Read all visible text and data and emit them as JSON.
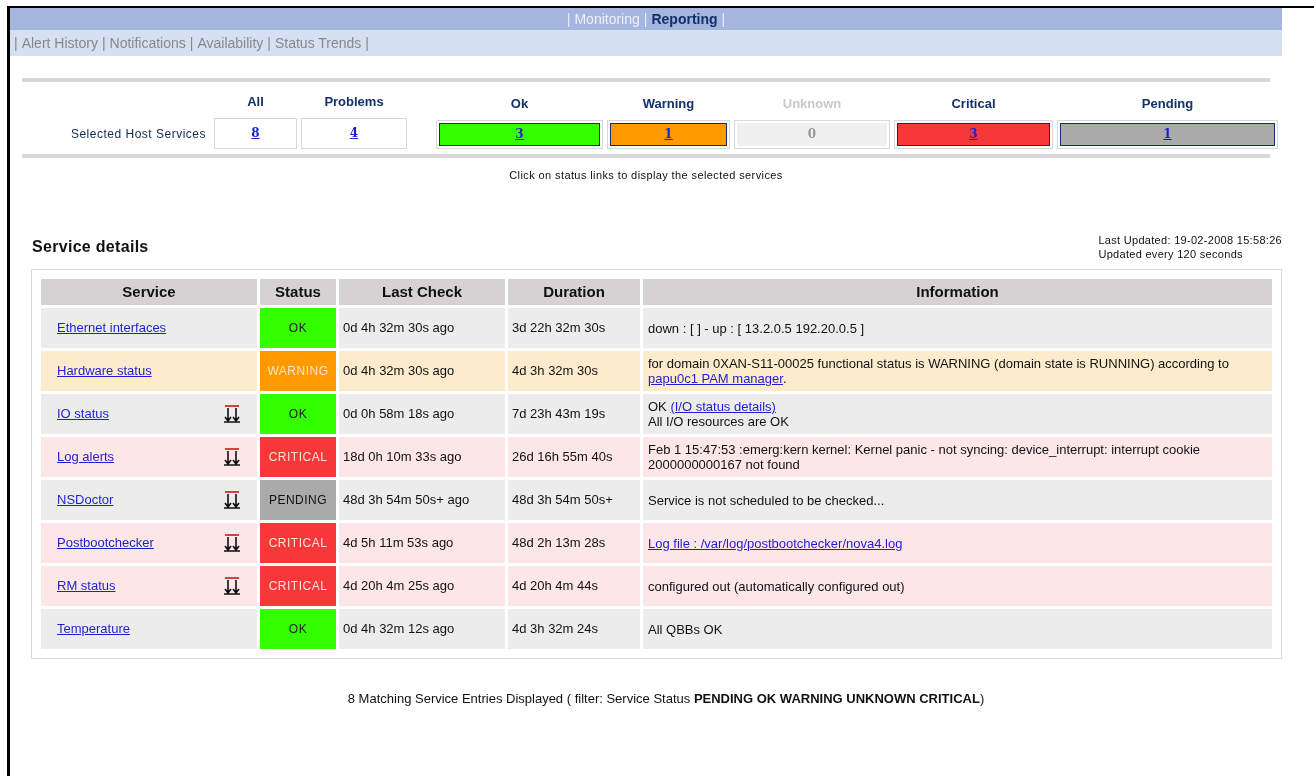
{
  "menu_separator": "|",
  "main_menu": [
    {
      "label": "Monitoring",
      "selected": false
    },
    {
      "label": "Reporting",
      "selected": true
    }
  ],
  "sub_menu": [
    "Alert History",
    "Notifications",
    "Availability",
    "Status Trends"
  ],
  "summary": {
    "row_label": "Selected Host Services",
    "note": "Click on status links to display the selected services",
    "items": [
      {
        "label": "All",
        "count": "8",
        "enabled": true,
        "kind": "plain"
      },
      {
        "label": "Problems",
        "count": "4",
        "enabled": true,
        "kind": "plain"
      },
      {
        "label": "Ok",
        "count": "3",
        "enabled": true,
        "kind": "status",
        "color": "#33ff00"
      },
      {
        "label": "Warning",
        "count": "1",
        "enabled": true,
        "kind": "status",
        "color": "#ff9900"
      },
      {
        "label": "Unknown",
        "count": "0",
        "enabled": false,
        "kind": "status",
        "color": "#f0f0f0"
      },
      {
        "label": "Critical",
        "count": "3",
        "enabled": true,
        "kind": "status",
        "color": "#f83838"
      },
      {
        "label": "Pending",
        "count": "1",
        "enabled": true,
        "kind": "status",
        "color": "#aaaaaa"
      }
    ]
  },
  "details": {
    "title": "Service details",
    "last_updated": "Last Updated: 19-02-2008 15:58:26",
    "update_interval": "Updated every 120 seconds",
    "columns": [
      "Service",
      "Status",
      "Last Check",
      "Duration",
      "Information"
    ],
    "rows": [
      {
        "service": "Ethernet interfaces",
        "easy_icon": false,
        "status": "OK",
        "kind": "ok",
        "last_check": "0d 4h 32m 30s ago",
        "duration": "3d 22h 32m 30s",
        "information": [
          {
            "kind": "text",
            "text": "down : [ ] - up : [ 13.2.0.5 192.20.0.5 ]"
          }
        ]
      },
      {
        "service": "Hardware status",
        "easy_icon": false,
        "status": "WARNING",
        "kind": "warning",
        "last_check": "0d 4h 32m 30s ago",
        "duration": "4d 3h 32m 30s",
        "information": [
          {
            "kind": "text",
            "text": "for domain 0XAN-S11-00025 functional status is WARNING (domain state is RUNNING) according to "
          },
          {
            "kind": "link",
            "text": "papu0c1 PAM manager"
          },
          {
            "kind": "text",
            "text": "."
          }
        ]
      },
      {
        "service": "IO status",
        "easy_icon": true,
        "status": "OK",
        "kind": "ok",
        "last_check": "0d 0h 58m 18s ago",
        "duration": "7d 23h 43m 19s",
        "information": [
          {
            "kind": "text",
            "text": "OK "
          },
          {
            "kind": "link",
            "text": "(I/O status details)"
          },
          {
            "kind": "break"
          },
          {
            "kind": "text",
            "text": "All I/O resources are OK"
          }
        ]
      },
      {
        "service": "Log alerts",
        "easy_icon": true,
        "status": "CRITICAL",
        "kind": "critical",
        "last_check": "18d 0h 10m 33s ago",
        "duration": "26d 16h 55m 40s",
        "information": [
          {
            "kind": "text",
            "text": "Feb 1 15:47:53 :emerg:kern kernel: Kernel panic - not syncing: device_interrupt: interrupt cookie 2000000000167 not found"
          }
        ]
      },
      {
        "service": "NSDoctor",
        "easy_icon": true,
        "status": "PENDING",
        "kind": "pending",
        "last_check": "48d 3h 54m 50s+ ago",
        "duration": "48d 3h 54m 50s+",
        "information": [
          {
            "kind": "text",
            "text": "Service is not scheduled to be checked..."
          }
        ]
      },
      {
        "service": "Postbootchecker",
        "easy_icon": true,
        "status": "CRITICAL",
        "kind": "critical",
        "last_check": "4d 5h 11m 53s ago",
        "duration": "48d 2h 13m 28s",
        "information": [
          {
            "kind": "link",
            "text": "Log file : /var/log/postbootchecker/nova4.log"
          }
        ]
      },
      {
        "service": "RM status",
        "easy_icon": true,
        "status": "CRITICAL",
        "kind": "critical",
        "last_check": "4d 20h 4m 25s ago",
        "duration": "4d 20h 4m 44s",
        "information": [
          {
            "kind": "text",
            "text": "configured out (automatically configured out)"
          }
        ]
      },
      {
        "service": "Temperature",
        "easy_icon": false,
        "status": "OK",
        "kind": "ok",
        "last_check": "0d 4h 32m 12s ago",
        "duration": "4d 3h 32m 24s",
        "information": [
          {
            "kind": "text",
            "text": "All QBBs OK"
          }
        ]
      }
    ],
    "footer": "8 Matching Service Entries Displayed ( filter: Service Status **PENDING OK WARNING UNKNOWN CRITICAL**)"
  }
}
